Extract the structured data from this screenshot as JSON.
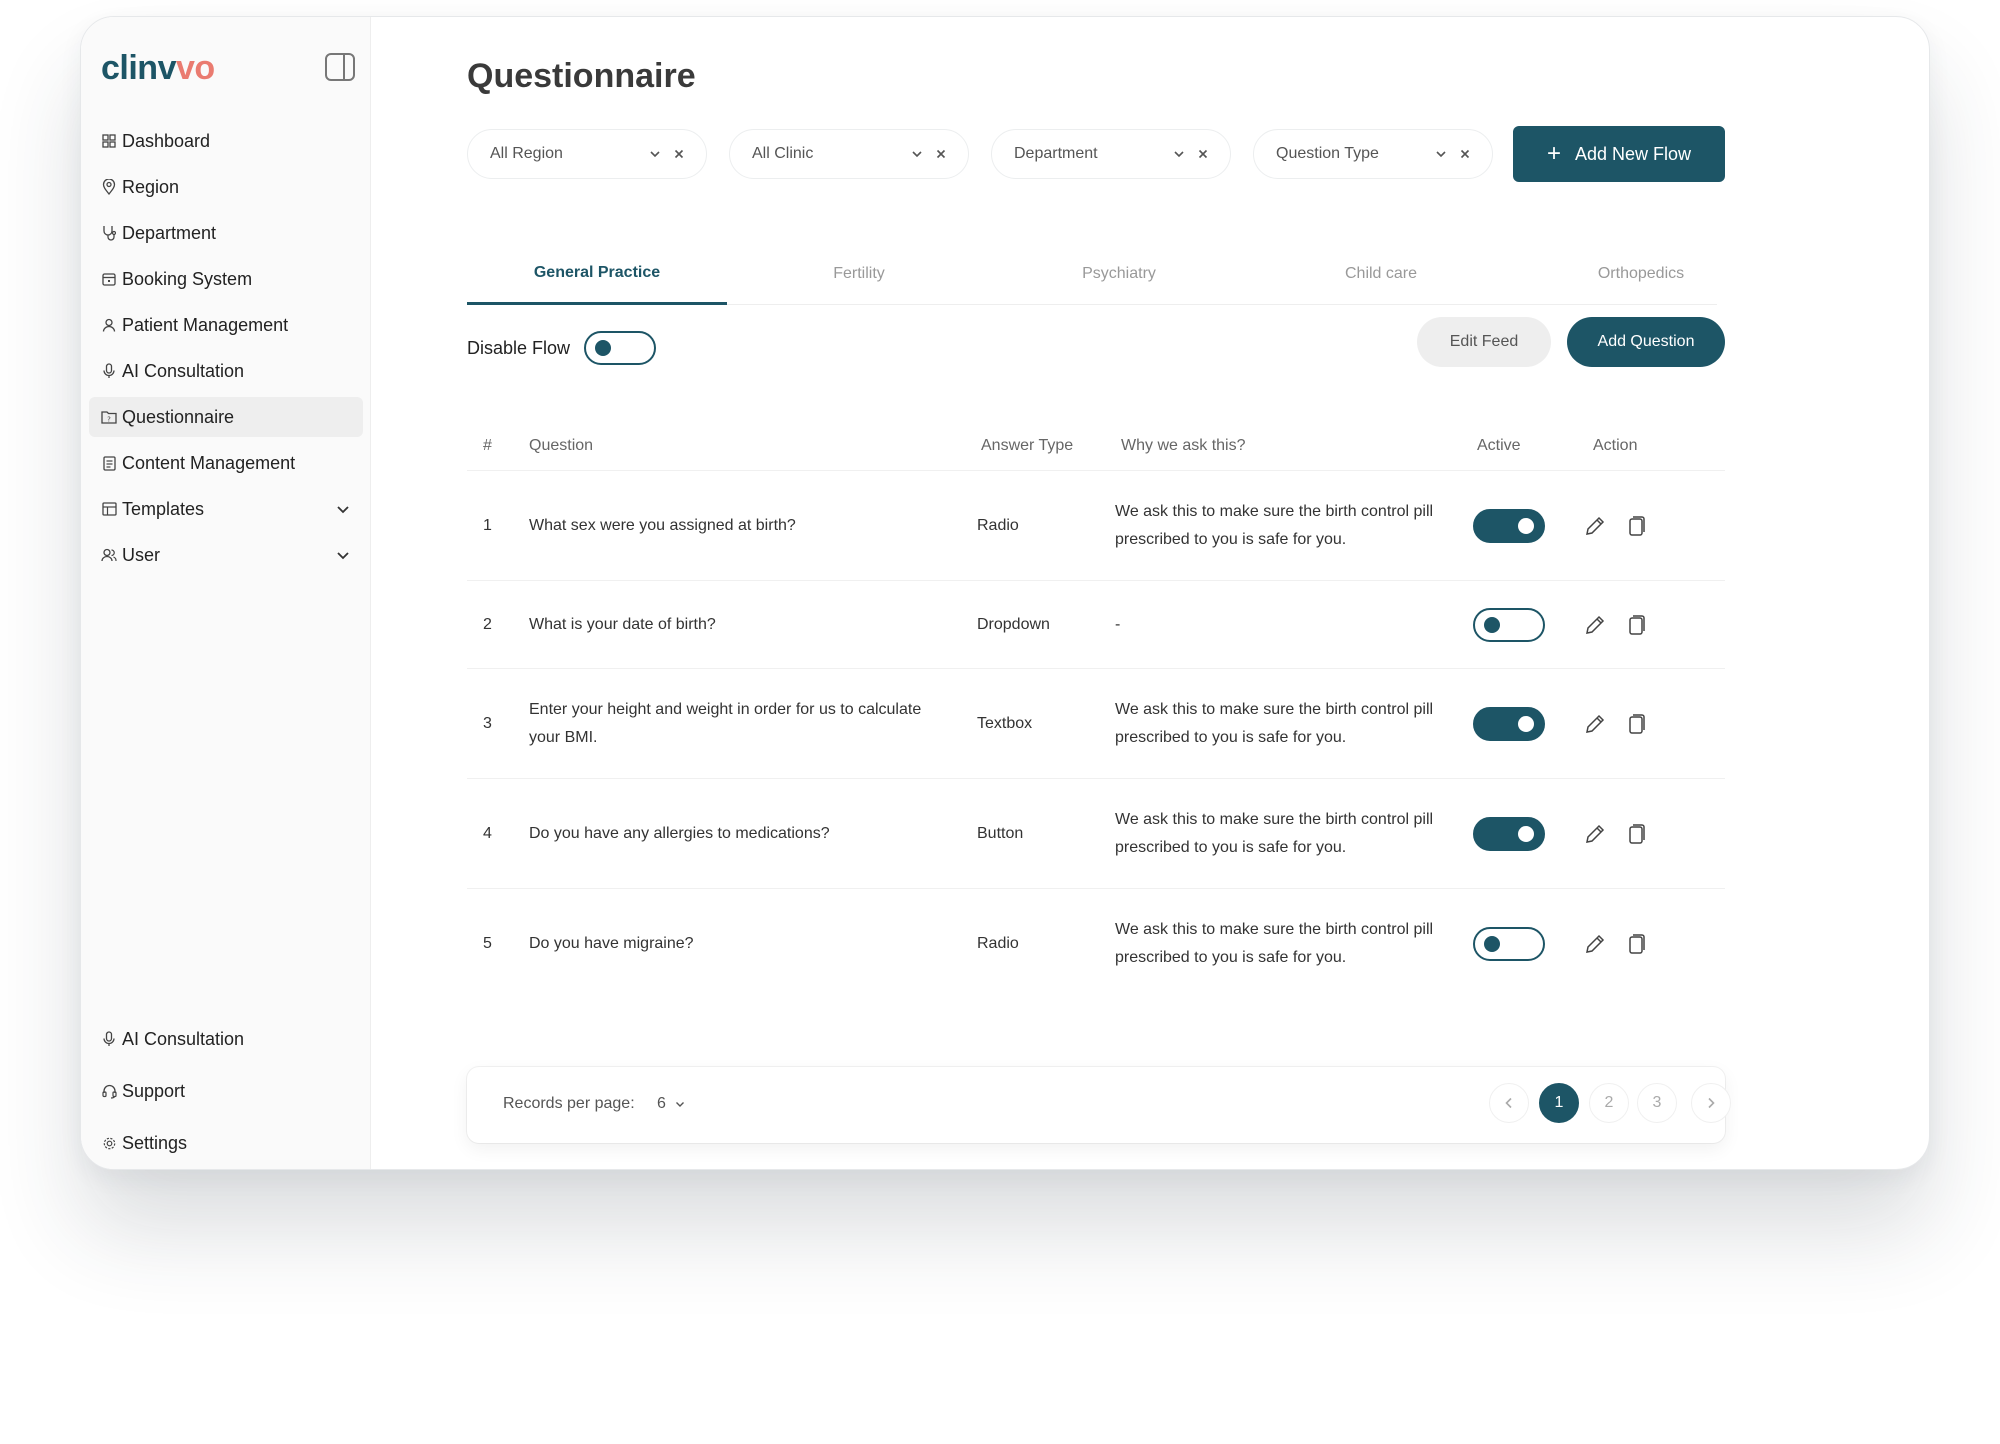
{
  "brand": {
    "name_main": "clinv",
    "name_accent": "vo"
  },
  "sidebar": {
    "items": [
      {
        "label": "Dashboard",
        "icon": "grid-icon"
      },
      {
        "label": "Region",
        "icon": "map-pin-icon"
      },
      {
        "label": "Department",
        "icon": "stethoscope-icon"
      },
      {
        "label": "Booking System",
        "icon": "calendar-icon"
      },
      {
        "label": "Patient Management",
        "icon": "user-icon"
      },
      {
        "label": "AI Consultation",
        "icon": "microphone-icon"
      },
      {
        "label": "Questionnaire",
        "icon": "folder-question-icon",
        "active": true
      },
      {
        "label": "Content Management",
        "icon": "document-icon"
      },
      {
        "label": "Templates",
        "icon": "table-icon",
        "expandable": true
      },
      {
        "label": "User",
        "icon": "users-icon",
        "expandable": true
      }
    ],
    "bottom_items": [
      {
        "label": "AI Consultation",
        "icon": "microphone-icon"
      },
      {
        "label": "Support",
        "icon": "headset-icon"
      },
      {
        "label": "Settings",
        "icon": "gear-icon"
      }
    ]
  },
  "page": {
    "title": "Questionnaire"
  },
  "filters": [
    {
      "label": "All Region"
    },
    {
      "label": "All Clinic"
    },
    {
      "label": "Department"
    },
    {
      "label": "Question Type"
    }
  ],
  "actions": {
    "add_flow": "Add New Flow",
    "edit_feed": "Edit Feed",
    "add_question": "Add Question",
    "disable_flow": "Disable Flow"
  },
  "tabs": [
    {
      "label": "General Practice",
      "active": true
    },
    {
      "label": "Fertility"
    },
    {
      "label": "Psychiatry"
    },
    {
      "label": "Child care"
    },
    {
      "label": "Orthopedics"
    }
  ],
  "table": {
    "headers": {
      "num": "#",
      "question": "Question",
      "answer_type": "Answer Type",
      "why": "Why we ask this?",
      "active": "Active",
      "action": "Action"
    },
    "rows": [
      {
        "num": "1",
        "question": "What sex were you assigned at birth?",
        "answer_type": "Radio",
        "why": "We ask this to make sure the birth control pill prescribed to you is safe for you.",
        "active": true
      },
      {
        "num": "2",
        "question": "What is your date of birth?",
        "answer_type": "Dropdown",
        "why": "-",
        "active": false
      },
      {
        "num": "3",
        "question": "Enter your height and weight in order for us to calculate your BMI.",
        "answer_type": "Textbox",
        "why": "We ask this to make sure the birth control pill prescribed to you is safe for you.",
        "active": true
      },
      {
        "num": "4",
        "question": "Do you have any allergies to medications?",
        "answer_type": "Button",
        "why": "We ask this to make sure the birth control pill prescribed to you is safe for you.",
        "active": true
      },
      {
        "num": "5",
        "question": "Do you have migraine?",
        "answer_type": "Radio",
        "why": "We ask this to make sure the birth control pill prescribed to you is safe for you.",
        "active": false
      }
    ]
  },
  "pagination": {
    "records_label": "Records per page:",
    "records_value": "6",
    "pages": [
      "1",
      "2",
      "3"
    ],
    "current": "1"
  },
  "colors": {
    "primary": "#1d5566",
    "accent": "#ea7b70"
  }
}
